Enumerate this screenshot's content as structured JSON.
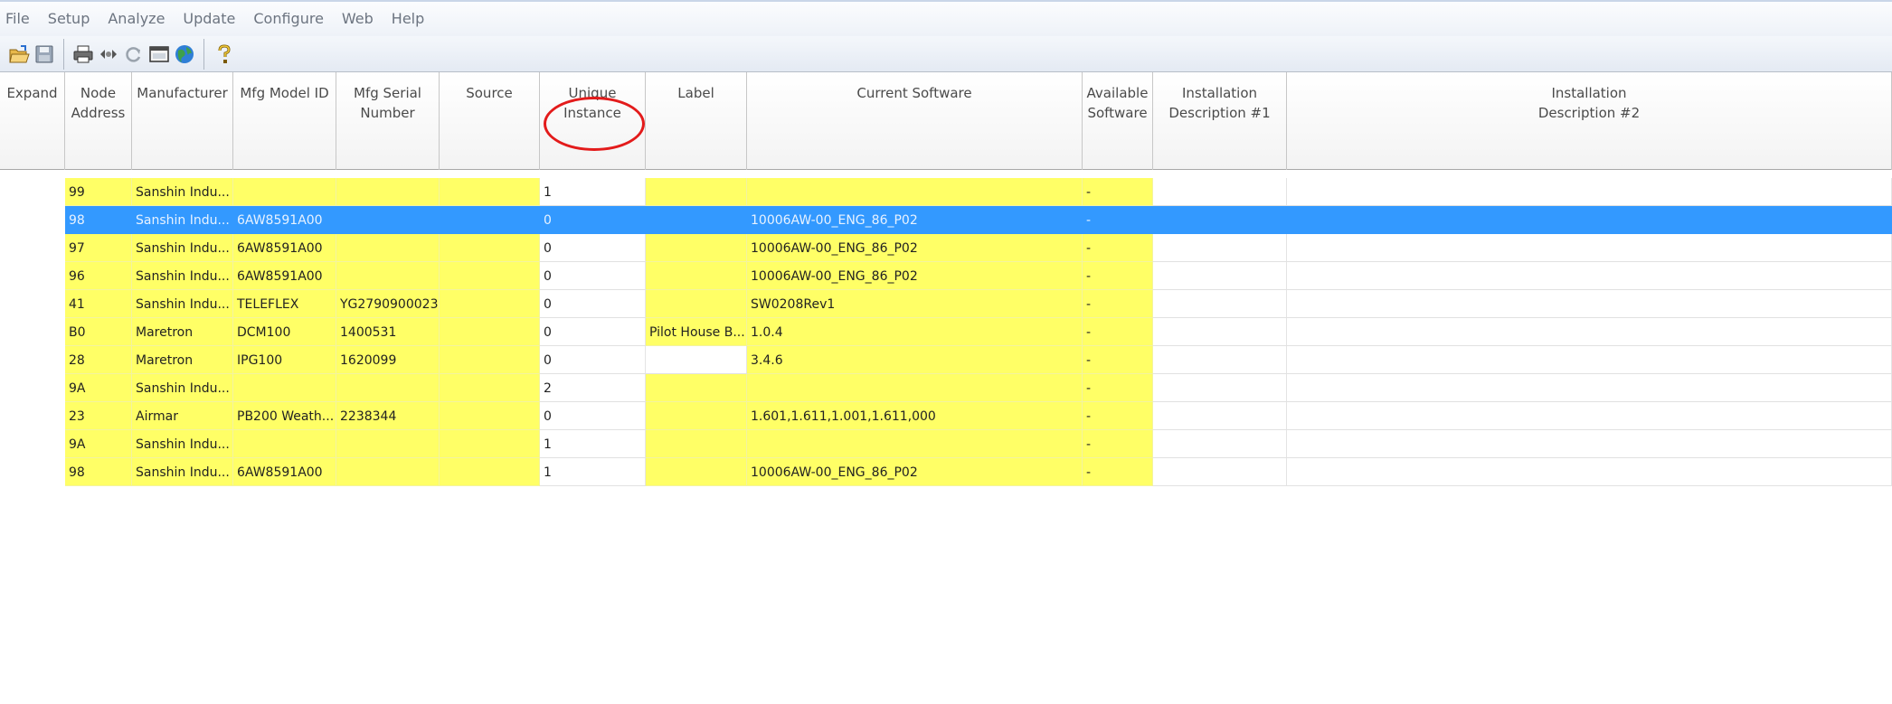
{
  "menu": [
    "File",
    "Setup",
    "Analyze",
    "Update",
    "Configure",
    "Web",
    "Help"
  ],
  "toolbar": {
    "icons": [
      "open-folder-icon",
      "save-disk-icon",
      "print-icon",
      "connect-icon",
      "refresh-icon",
      "window-icon",
      "globe-icon",
      "help-icon"
    ]
  },
  "grid": {
    "columns": [
      {
        "key": "expand",
        "label": "Expand"
      },
      {
        "key": "node",
        "label": "Node\nAddress"
      },
      {
        "key": "mfr",
        "label": "Manufacturer"
      },
      {
        "key": "model",
        "label": "Mfg Model ID"
      },
      {
        "key": "serial",
        "label": "Mfg Serial\nNumber"
      },
      {
        "key": "source",
        "label": "Source"
      },
      {
        "key": "instance",
        "label": "Unique\nInstance"
      },
      {
        "key": "label",
        "label": "Label"
      },
      {
        "key": "current_sw",
        "label": "Current Software"
      },
      {
        "key": "avail_sw",
        "label": "Available\nSoftware"
      },
      {
        "key": "inst1",
        "label": "Installation\nDescription #1"
      },
      {
        "key": "inst2",
        "label": "Installation\nDescription #2"
      }
    ],
    "selected_row": 1,
    "rows": [
      {
        "node": "99",
        "mfr": "Sanshin Indu...",
        "model": "",
        "serial": "",
        "source": "",
        "instance": "1",
        "label": "",
        "current_sw": "",
        "avail_sw": "-"
      },
      {
        "node": "98",
        "mfr": "Sanshin Indu...",
        "model": "6AW8591A00",
        "serial": "",
        "source": "",
        "instance": "0",
        "label": "",
        "current_sw": "10006AW-00_ENG_86_P02",
        "avail_sw": "-"
      },
      {
        "node": "97",
        "mfr": "Sanshin Indu...",
        "model": "6AW8591A00",
        "serial": "",
        "source": "",
        "instance": "0",
        "label": "",
        "current_sw": "10006AW-00_ENG_86_P02",
        "avail_sw": "-"
      },
      {
        "node": "96",
        "mfr": "Sanshin Indu...",
        "model": "6AW8591A00",
        "serial": "",
        "source": "",
        "instance": "0",
        "label": "",
        "current_sw": "10006AW-00_ENG_86_P02",
        "avail_sw": "-"
      },
      {
        "node": "41",
        "mfr": "Sanshin Indu...",
        "model": "TELEFLEX",
        "serial": "YG2790900023",
        "source": "",
        "instance": "0",
        "label": "",
        "current_sw": "SW0208Rev1",
        "avail_sw": "-"
      },
      {
        "node": "B0",
        "mfr": "Maretron",
        "model": "DCM100",
        "serial": "1400531",
        "source": "",
        "instance": "0",
        "label": "Pilot House B...",
        "current_sw": "1.0.4",
        "avail_sw": "-"
      },
      {
        "node": "28",
        "mfr": "Maretron",
        "model": "IPG100",
        "serial": "1620099",
        "source": "",
        "instance": "0",
        "label": "",
        "current_sw": "3.4.6",
        "avail_sw": "-"
      },
      {
        "node": "9A",
        "mfr": "Sanshin Indu...",
        "model": "",
        "serial": "",
        "source": "",
        "instance": "2",
        "label": "",
        "current_sw": "",
        "avail_sw": "-"
      },
      {
        "node": "23",
        "mfr": "Airmar",
        "model": "PB200 Weath...",
        "serial": "2238344",
        "source": "",
        "instance": "0",
        "label": "",
        "current_sw": "1.601,1.611,1.001,1.611,000",
        "avail_sw": "-"
      },
      {
        "node": "9A",
        "mfr": "Sanshin Indu...",
        "model": "",
        "serial": "",
        "source": "",
        "instance": "1",
        "label": "",
        "current_sw": "",
        "avail_sw": "-"
      },
      {
        "node": "98",
        "mfr": "Sanshin Indu...",
        "model": "6AW8591A00",
        "serial": "",
        "source": "",
        "instance": "1",
        "label": "",
        "current_sw": "10006AW-00_ENG_86_P02",
        "avail_sw": "-"
      }
    ]
  },
  "colors": {
    "editable_cell": "#ffff66",
    "selection": "#3399ff",
    "highlight_circle": "#e31b1b"
  }
}
